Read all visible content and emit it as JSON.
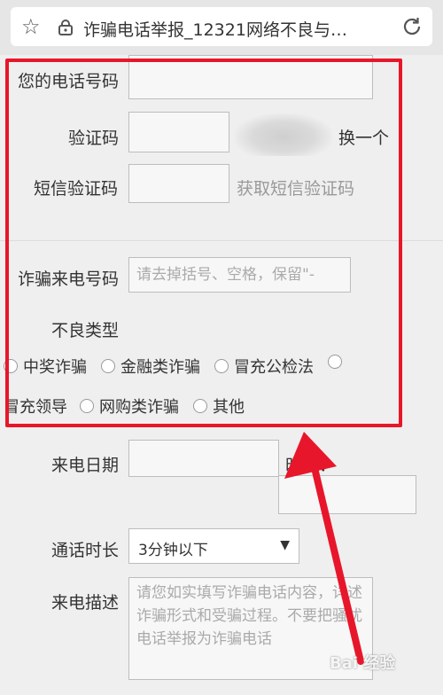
{
  "browser": {
    "url_title": "诈骗电话举报_12321网络不良与…"
  },
  "form": {
    "phone_label": "您的电话号码",
    "phone_value": "",
    "captcha_label": "验证码",
    "captcha_value": "",
    "captcha_refresh": "换一个",
    "sms_label": "短信验证码",
    "sms_value": "",
    "sms_get_code": "获取短信验证码",
    "fraud_number_label": "诈骗来电号码",
    "fraud_number_placeholder": "请去掉括号、空格，保留\"-",
    "type_label": "不良类型",
    "types": [
      "中奖诈骗",
      "金融类诈骗",
      "冒充公检法",
      "冒充领导",
      "网购类诈骗",
      "其他"
    ],
    "date_label": "来电日期",
    "time_label": "时间：",
    "duration_label": "通话时长",
    "duration_value": "3分钟以下",
    "description_label": "来电描述",
    "description_placeholder": "请您如实填写诈骗电话内容，详述诈骗形式和受骗过程。不要把骚扰电话举报为诈骗电话"
  },
  "watermark": "Bai 经验",
  "colors": {
    "highlight": "#e8162a",
    "background": "#efefef"
  }
}
